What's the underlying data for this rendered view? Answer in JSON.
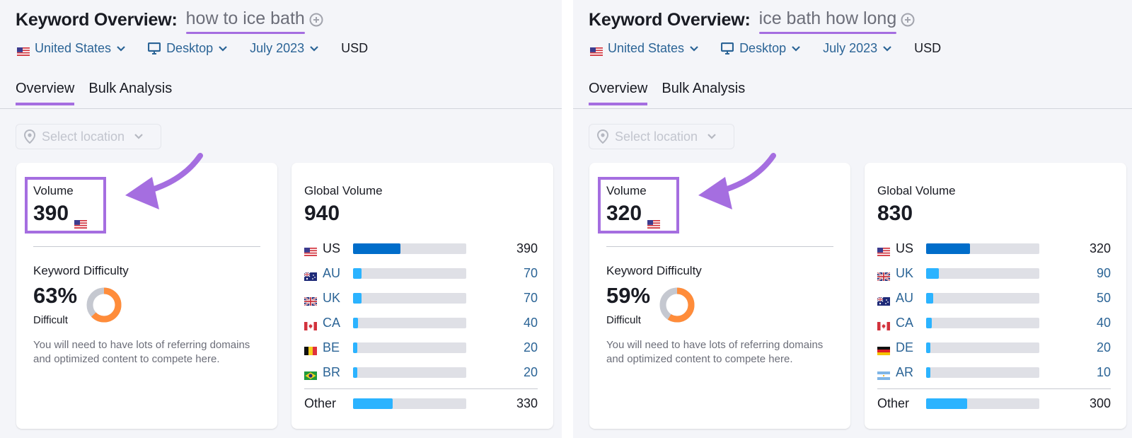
{
  "panels": [
    {
      "title_label": "Keyword Overview:",
      "keyword": "how to ice bath",
      "filters": {
        "country": "United States",
        "device": "Desktop",
        "date": "July 2023",
        "currency": "USD"
      },
      "tabs": [
        {
          "label": "Overview",
          "active": true
        },
        {
          "label": "Bulk Analysis",
          "active": false
        }
      ],
      "location_placeholder": "Select location",
      "volume": {
        "label": "Volume",
        "value": "390"
      },
      "keyword_difficulty": {
        "label": "Keyword Difficulty",
        "value": "63%",
        "percent": 63,
        "status": "Difficult",
        "description": "You will need to have lots of referring domains and optimized content to compete here."
      },
      "global_volume": {
        "label": "Global Volume",
        "value": "940",
        "rows": [
          {
            "code": "US",
            "flag": "us",
            "value": "390",
            "fraction": 0.42,
            "primary": true
          },
          {
            "code": "AU",
            "flag": "au",
            "value": "70",
            "fraction": 0.075
          },
          {
            "code": "UK",
            "flag": "uk",
            "value": "70",
            "fraction": 0.075
          },
          {
            "code": "CA",
            "flag": "ca",
            "value": "40",
            "fraction": 0.043
          },
          {
            "code": "BE",
            "flag": "be",
            "value": "20",
            "fraction": 0.021
          },
          {
            "code": "BR",
            "flag": "br",
            "value": "20",
            "fraction": 0.021
          }
        ],
        "other": {
          "label": "Other",
          "value": "330",
          "fraction": 0.35
        }
      }
    },
    {
      "title_label": "Keyword Overview:",
      "keyword": "ice bath how long",
      "filters": {
        "country": "United States",
        "device": "Desktop",
        "date": "July 2023",
        "currency": "USD"
      },
      "tabs": [
        {
          "label": "Overview",
          "active": true
        },
        {
          "label": "Bulk Analysis",
          "active": false
        }
      ],
      "location_placeholder": "Select location",
      "volume": {
        "label": "Volume",
        "value": "320"
      },
      "keyword_difficulty": {
        "label": "Keyword Difficulty",
        "value": "59%",
        "percent": 59,
        "status": "Difficult",
        "description": "You will need to have lots of referring domains and optimized content to compete here."
      },
      "global_volume": {
        "label": "Global Volume",
        "value": "830",
        "rows": [
          {
            "code": "US",
            "flag": "us",
            "value": "320",
            "fraction": 0.39,
            "primary": true
          },
          {
            "code": "UK",
            "flag": "uk",
            "value": "90",
            "fraction": 0.11
          },
          {
            "code": "AU",
            "flag": "au",
            "value": "50",
            "fraction": 0.06
          },
          {
            "code": "CA",
            "flag": "ca",
            "value": "40",
            "fraction": 0.048
          },
          {
            "code": "DE",
            "flag": "de",
            "value": "20",
            "fraction": 0.024
          },
          {
            "code": "AR",
            "flag": "ar",
            "value": "10",
            "fraction": 0.012
          }
        ],
        "other": {
          "label": "Other",
          "value": "300",
          "fraction": 0.36
        }
      }
    }
  ],
  "colors": {
    "accent_purple": "#a56ee0",
    "link_blue": "#2b6496",
    "bar_primary": "#006dca",
    "bar_secondary": "#2bb3ff",
    "bar_track": "#dfe0e6",
    "kd_orange": "#ff8c3a",
    "kd_track": "#c5c8d0"
  }
}
